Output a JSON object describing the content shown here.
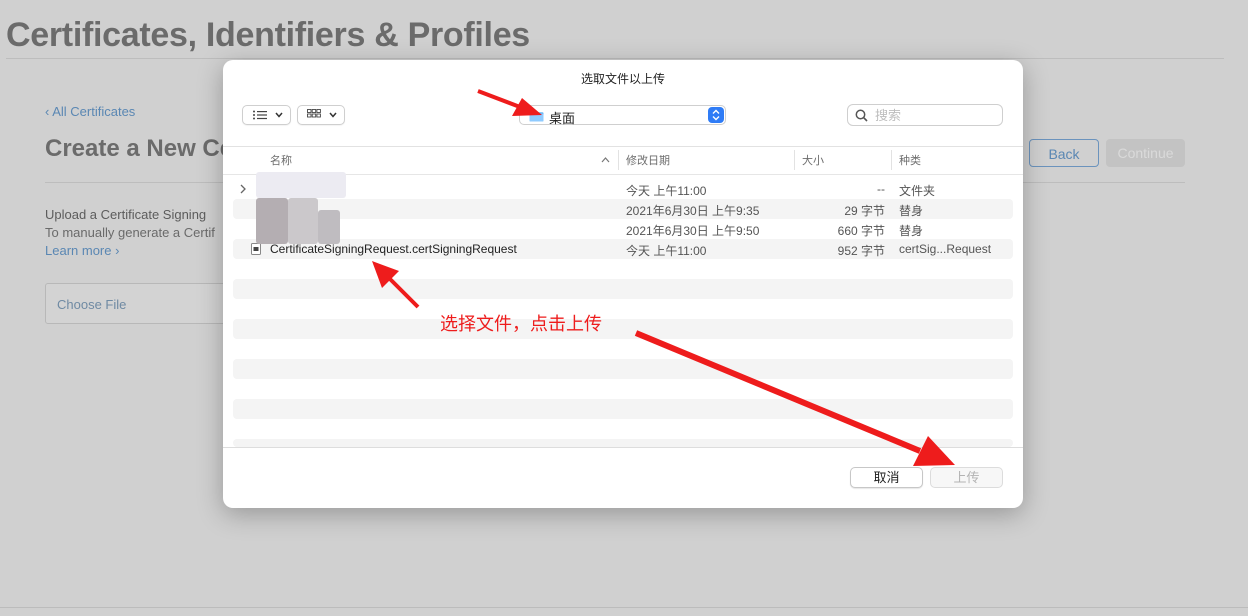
{
  "background_page": {
    "title": "Certificates, Identifiers & Profiles",
    "back_link": "‹ All Certificates",
    "subtitle": "Create a New Ce",
    "back_button": "Back",
    "continue_button": "Continue",
    "upload_heading": "Upload a Certificate Signing",
    "upload_text": "To manually generate a Certif",
    "learn_more": "Learn more ›",
    "choose_file": "Choose File"
  },
  "dialog": {
    "title": "选取文件以上传",
    "location": "桌面",
    "search_placeholder": "搜索",
    "view_list_icon": "list-icon",
    "view_grid_icon": "grid-icon",
    "columns": {
      "name": "名称",
      "modified": "修改日期",
      "size": "大小",
      "kind": "种类"
    },
    "rows": [
      {
        "name": "",
        "date": "今天 上午11:00",
        "size": "--",
        "kind": "文件夹"
      },
      {
        "name": "",
        "date": "2021年6月30日 上午9:35",
        "size": "29 字节",
        "kind": "替身"
      },
      {
        "name": "",
        "date": "2021年6月30日 上午9:50",
        "size": "660 字节",
        "kind": "替身"
      },
      {
        "name": "CertificateSigningRequest.certSigningRequest",
        "date": "今天 上午11:00",
        "size": "952 字节",
        "kind": "certSig...Request"
      }
    ],
    "cancel_button": "取消",
    "upload_button": "上传"
  },
  "annotation": {
    "instruction": "选择文件，点击上传",
    "color": "#ee1c1c"
  }
}
